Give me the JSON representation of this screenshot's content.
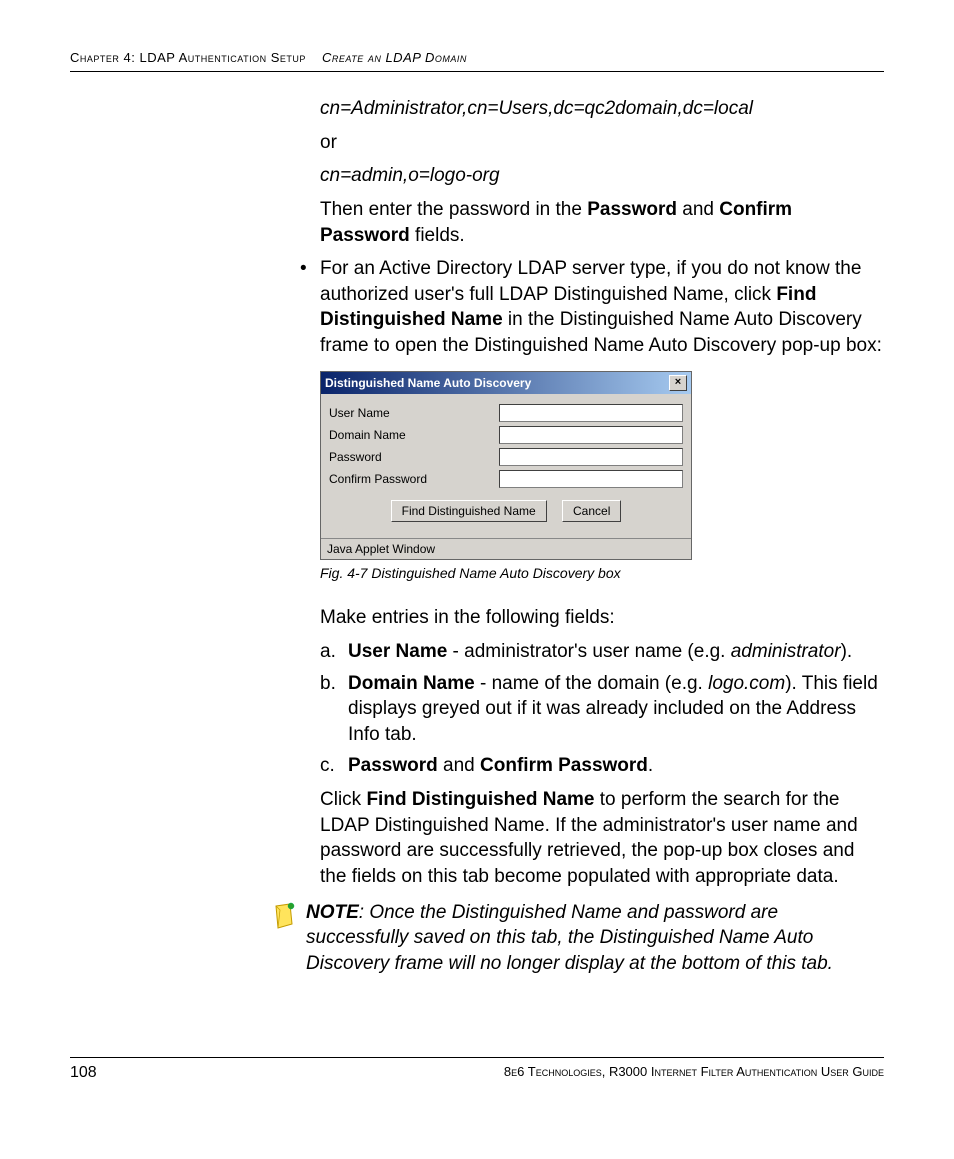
{
  "header": {
    "chapter": "Chapter 4: LDAP Authentication Setup",
    "section": "Create an LDAP Domain"
  },
  "body": {
    "dn_example1": "cn=Administrator,cn=Users,dc=qc2domain,dc=local",
    "or": "or",
    "dn_example2": "cn=admin,o=logo-org",
    "pw_line_pre": "Then enter the password in the ",
    "pw_label": "Password",
    "pw_line_mid": " and ",
    "confirm_pw_label": "Confirm Password",
    "pw_line_post": " fields.",
    "bullet_pre": "For an Active Directory LDAP server type, if you do not know the authorized user's full LDAP Distinguished Name, click ",
    "bullet_bold": "Find Distinguished Name",
    "bullet_post": " in the Distinguished Name Auto Discovery frame to open the Distinguished Name Auto Discovery pop-up box:",
    "make_entries": "Make entries in the following fields:",
    "item_a_marker": "a.",
    "item_a_bold": "User Name",
    "item_a_mid": " - administrator's user name (e.g. ",
    "item_a_italic": "administrator",
    "item_a_end": ").",
    "item_b_marker": "b.",
    "item_b_bold": "Domain Name",
    "item_b_mid": " - name of the domain (e.g. ",
    "item_b_italic": "logo.com",
    "item_b_end": "). This field displays greyed out if it was already included on the Address Info tab.",
    "item_c_marker": "c.",
    "item_c_bold1": "Password",
    "item_c_mid": " and ",
    "item_c_bold2": "Confirm Password",
    "item_c_end": ".",
    "click_pre": "Click ",
    "click_bold": "Find Distinguished Name",
    "click_post": " to perform the search for the LDAP Distinguished Name. If the administrator's user name and password are successfully retrieved, the pop-up box closes and the fields on this tab become populated with appropriate data."
  },
  "dialog": {
    "title": "Distinguished Name Auto Discovery",
    "close": "×",
    "labels": {
      "user_name": "User Name",
      "domain_name": "Domain Name",
      "password": "Password",
      "confirm_password": "Confirm Password"
    },
    "buttons": {
      "find": "Find Distinguished Name",
      "cancel": "Cancel"
    },
    "status": "Java Applet Window"
  },
  "figure_caption": "Fig. 4-7  Distinguished Name Auto Discovery box",
  "note": {
    "label": "NOTE",
    "text": ": Once the Distinguished Name and password are successfully saved on this tab, the Distinguished Name Auto Discovery frame will no longer display at the bottom of this tab."
  },
  "footer": {
    "page": "108",
    "right": "8e6 Technologies, R3000 Internet Filter Authentication User Guide"
  }
}
